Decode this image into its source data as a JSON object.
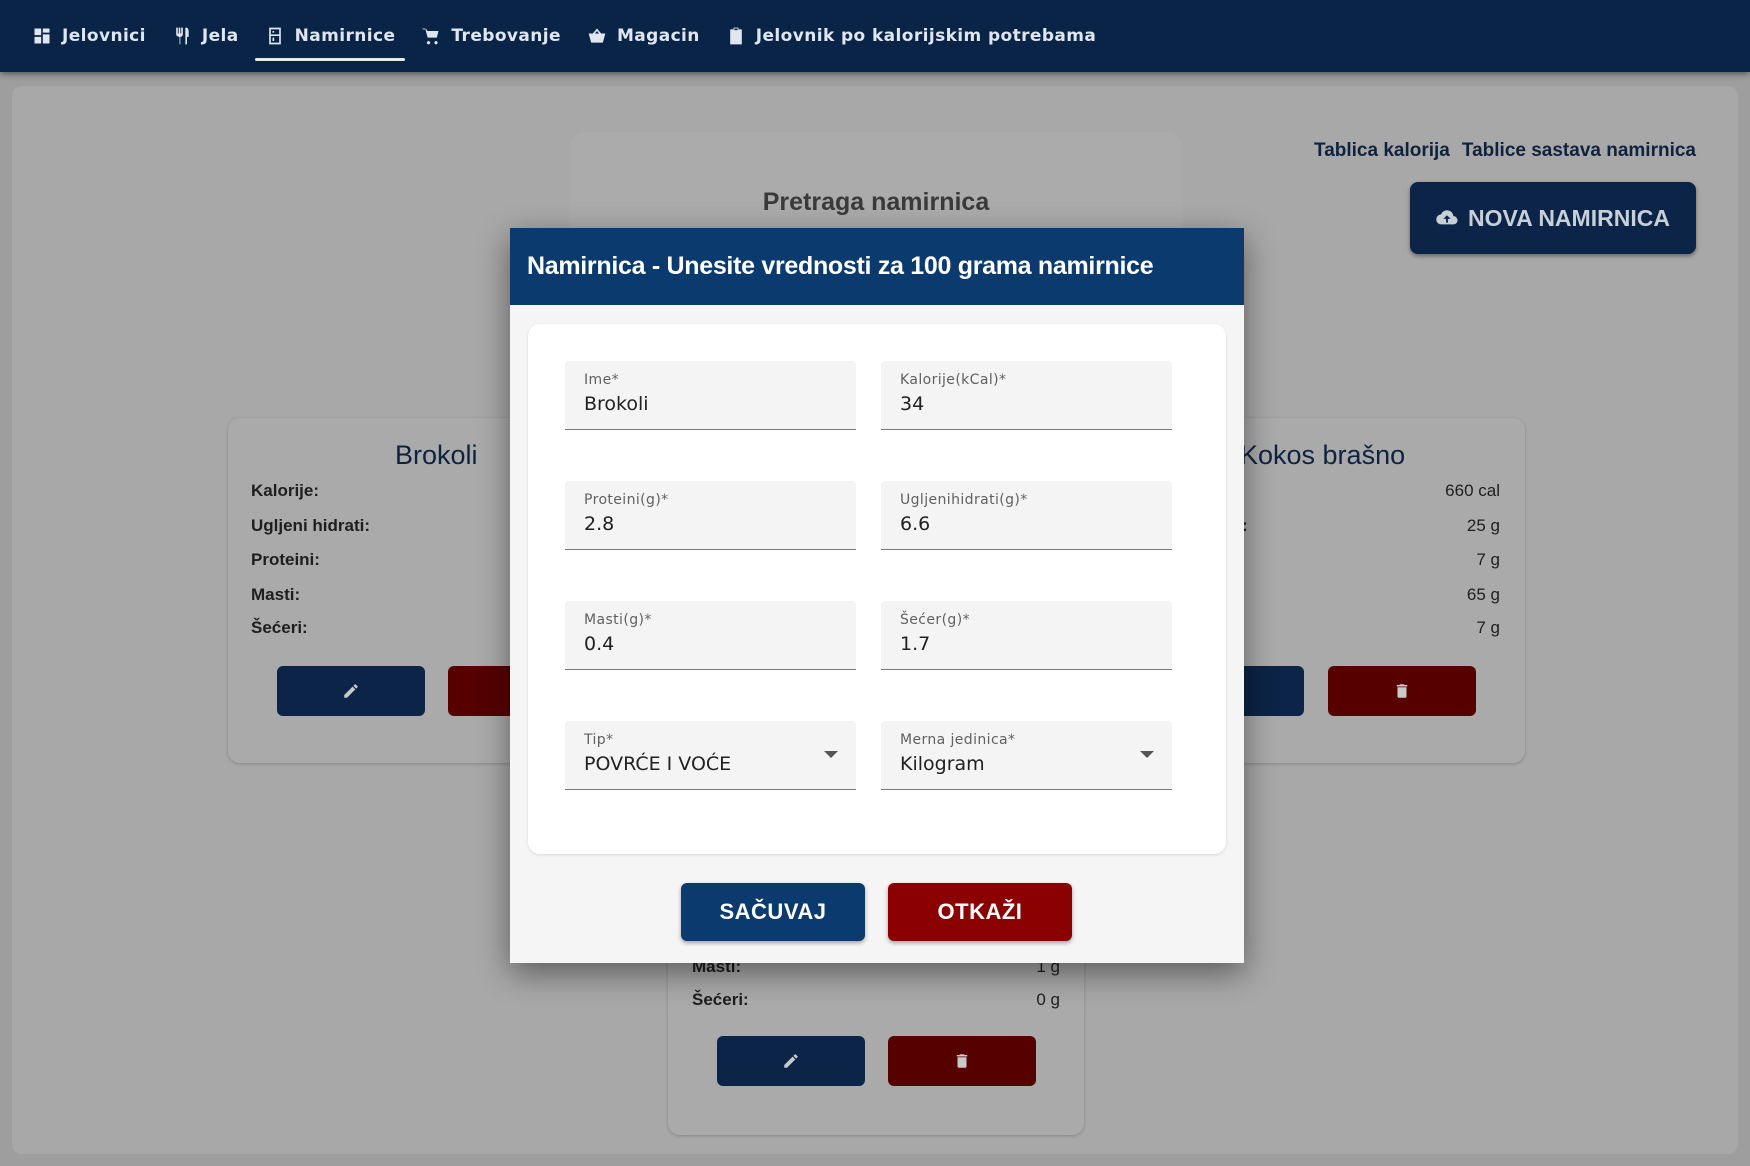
{
  "nav": {
    "items": [
      {
        "label": "Jelovnici",
        "icon": "grid-icon"
      },
      {
        "label": "Jela",
        "icon": "utensils-icon"
      },
      {
        "label": "Namirnice",
        "icon": "food-icon",
        "active": true
      },
      {
        "label": "Trebovanje",
        "icon": "cart-icon"
      },
      {
        "label": "Magacin",
        "icon": "basket-icon"
      },
      {
        "label": "Jelovnik po kalorijskim potrebama",
        "icon": "clipboard-icon"
      }
    ]
  },
  "page": {
    "links": [
      "Tablica kalorija",
      "Tablice sastava namirnica"
    ],
    "new_button": "NOVA NAMIRNICA",
    "search_title": "Pretraga namirnica",
    "cards": [
      {
        "title": "Brokoli",
        "rows": [
          "Kalorije:",
          "Ugljeni hidrati:",
          "Proteini:",
          "Masti:",
          "Šećeri:"
        ]
      },
      {
        "title": "Kokos brašno",
        "row_partial": ":",
        "values": [
          "660 cal",
          "25 g",
          "7 g",
          "65 g",
          "7 g"
        ]
      },
      {
        "rows": [
          "Masti:",
          "Šećeri:"
        ],
        "values": [
          "1 g",
          "0 g"
        ]
      }
    ]
  },
  "modal": {
    "title": "Namirnica - Unesite vrednosti za 100 grama namirnice",
    "fields": [
      {
        "label": "Ime*",
        "value": "Brokoli"
      },
      {
        "label": "Kalorije(kCal)*",
        "value": "34"
      },
      {
        "label": "Proteini(g)*",
        "value": "2.8"
      },
      {
        "label": "Ugljenihidrati(g)*",
        "value": "6.6"
      },
      {
        "label": "Masti(g)*",
        "value": "0.4"
      },
      {
        "label": "Šećer(g)*",
        "value": "1.7"
      },
      {
        "label": "Tip*",
        "value": "POVRĆE I VOĆE"
      },
      {
        "label": "Merna jedinica*",
        "value": "Kilogram"
      }
    ],
    "save": "SAČUVAJ",
    "cancel": "OTKAŽI"
  },
  "colors": {
    "nav_bg": "#0a2447",
    "modal_header": "#0b3a6e",
    "save_button": "#0b3a6e",
    "cancel_button": "#8b0000"
  }
}
